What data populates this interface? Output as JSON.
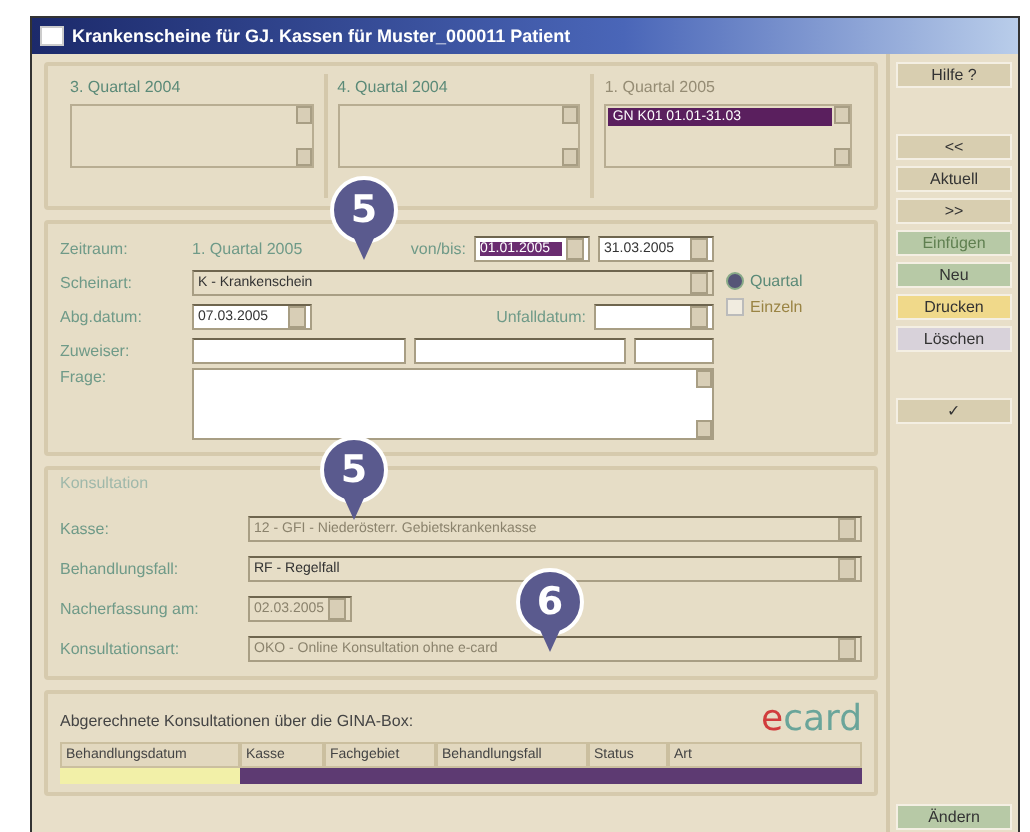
{
  "window": {
    "title": "Krankenscheine für GJ. Kassen für Muster_000011 Patient"
  },
  "quarters": [
    {
      "label": "3. Quartal 2004",
      "disabled": false
    },
    {
      "label": "4. Quartal 2004",
      "disabled": false
    },
    {
      "label": "1. Quartal 2005",
      "disabled": true,
      "entries": [
        {
          "text": "GN K01 01.01-31.03",
          "selected": true
        }
      ]
    }
  ],
  "period": {
    "label": "Zeitraum:",
    "value": "1. Quartal 2005",
    "range_label": "von/bis:",
    "from": "01.01.2005",
    "to": "31.03.2005"
  },
  "scheinart": {
    "label": "Scheinart:",
    "value": "K - Krankenschein"
  },
  "options": [
    {
      "kind": "radio",
      "label": "Quartal",
      "checked": true,
      "disabled": false
    },
    {
      "kind": "checkbox",
      "label": "Einzeln",
      "checked": false,
      "disabled": true
    }
  ],
  "abg_datum": {
    "label": "Abg.datum:",
    "value": "07.03.2005"
  },
  "unfalldatum": {
    "label": "Unfalldatum:"
  },
  "zuweiser": {
    "label": "Zuweiser:"
  },
  "frage": {
    "label": "Frage:"
  },
  "konsultation": {
    "title": "Konsultation",
    "fields": [
      {
        "kind": "select",
        "label": "Kasse:",
        "value": "12 - GFI - Niederösterr. Gebietskrankenkasse",
        "disabled": true
      },
      {
        "kind": "select",
        "label": "Behandlungsfall:",
        "value": "RF - Regelfall",
        "disabled": false
      },
      {
        "kind": "date",
        "label": "Nacherfassung am:",
        "value": "02.03.2005",
        "disabled": true
      },
      {
        "kind": "select",
        "label": "Konsultationsart:",
        "value": "OKO - Online Konsultation ohne e-card",
        "disabled": true
      }
    ]
  },
  "billed": {
    "title": "Abgerechnete Konsultationen über die GINA-Box:",
    "logo_prefix": "e",
    "logo_rest": "card",
    "columns": [
      "Behandlungsdatum",
      "Kasse",
      "Fachgebiet",
      "Behandlungsfall",
      "Status",
      "Art"
    ]
  },
  "button_groups": [
    [
      {
        "label": "Hilfe ?",
        "color": "#d8ceb0",
        "disabled": false
      }
    ],
    [
      {
        "label": "<<",
        "color": "#d8ceb0",
        "disabled": false
      },
      {
        "label": "Aktuell",
        "color": "#d8ceb0",
        "disabled": false
      },
      {
        "label": ">>",
        "color": "#d8ceb0",
        "disabled": false
      },
      {
        "label": "Einfügen",
        "color": "#b7c9a6",
        "disabled": true
      },
      {
        "label": "Neu",
        "color": "#b7c9a6",
        "disabled": false
      },
      {
        "label": "Drucken",
        "color": "#f0d98a",
        "disabled": false
      },
      {
        "label": "Löschen",
        "color": "#d8d2da",
        "disabled": false
      }
    ],
    [
      {
        "label": "✓",
        "color": "#d8ceb0",
        "disabled": false
      }
    ]
  ],
  "bottom_buttons": [
    {
      "label": "Ändern",
      "color": "#b7c9a6",
      "disabled": false
    }
  ],
  "callouts": [
    {
      "number": "5"
    },
    {
      "number": "5"
    },
    {
      "number": "6"
    }
  ]
}
